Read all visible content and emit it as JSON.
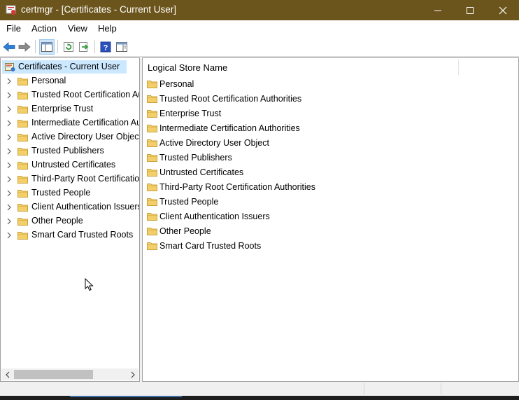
{
  "window": {
    "title": "certmgr - [Certificates - Current User]",
    "icons": {
      "app": "certificate-app-icon",
      "minimize": "minimize-icon",
      "maximize": "maximize-icon",
      "close": "close-icon"
    },
    "colors": {
      "titlebar": "#6b551c",
      "selection": "#cce8ff",
      "folder": "#f2cf6a"
    }
  },
  "menu": {
    "file": "File",
    "action": "Action",
    "view": "View",
    "help": "Help"
  },
  "toolbar": {
    "icons": [
      "back-arrow-icon",
      "forward-arrow-icon",
      "show-hide-console-tree-icon",
      "refresh-icon",
      "export-list-icon",
      "help-icon",
      "action-pane-icon"
    ]
  },
  "tree": {
    "root": "Certificates - Current User",
    "items": [
      "Personal",
      "Trusted Root Certification Authorities",
      "Enterprise Trust",
      "Intermediate Certification Authorities",
      "Active Directory User Object",
      "Trusted Publishers",
      "Untrusted Certificates",
      "Third-Party Root Certification Authorities",
      "Trusted People",
      "Client Authentication Issuers",
      "Other People",
      "Smart Card Trusted Roots"
    ],
    "scrollbar_fraction": 0.6
  },
  "list": {
    "column_header": "Logical Store Name",
    "items": [
      "Personal",
      "Trusted Root Certification Authorities",
      "Enterprise Trust",
      "Intermediate Certification Authorities",
      "Active Directory User Object",
      "Trusted Publishers",
      "Untrusted Certificates",
      "Third-Party Root Certification Authorities",
      "Trusted People",
      "Client Authentication Issuers",
      "Other People",
      "Smart Card Trusted Roots"
    ]
  }
}
